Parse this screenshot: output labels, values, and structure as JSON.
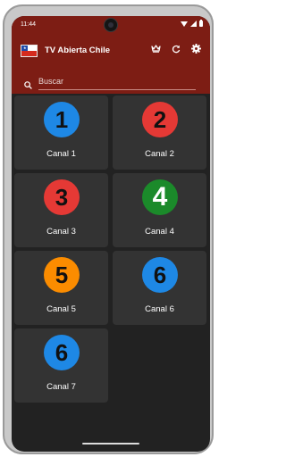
{
  "status_bar": {
    "time": "11:44"
  },
  "app_bar": {
    "title": "TV Abierta Chile",
    "icons": [
      "chile-flag-icon",
      "crown-icon",
      "refresh-icon",
      "settings-icon"
    ]
  },
  "search": {
    "placeholder": "Buscar",
    "value": ""
  },
  "channels": [
    {
      "number": "1",
      "label": "Canal 1",
      "color": "#1e88e5"
    },
    {
      "number": "2",
      "label": "Canal 2",
      "color": "#e53935"
    },
    {
      "number": "3",
      "label": "Canal 3",
      "color": "#e53935"
    },
    {
      "number": "4",
      "label": "Canal 4",
      "color": "#1b8a2a"
    },
    {
      "number": "5",
      "label": "Canal 5",
      "color": "#fb8c00"
    },
    {
      "number": "6",
      "label": "Canal 6",
      "color": "#1e88e5"
    },
    {
      "number": "6",
      "label": "Canal 7",
      "color": "#1e88e5"
    }
  ],
  "colors": {
    "app_bar": "#7d1d14",
    "background": "#222222",
    "card": "#333333"
  }
}
